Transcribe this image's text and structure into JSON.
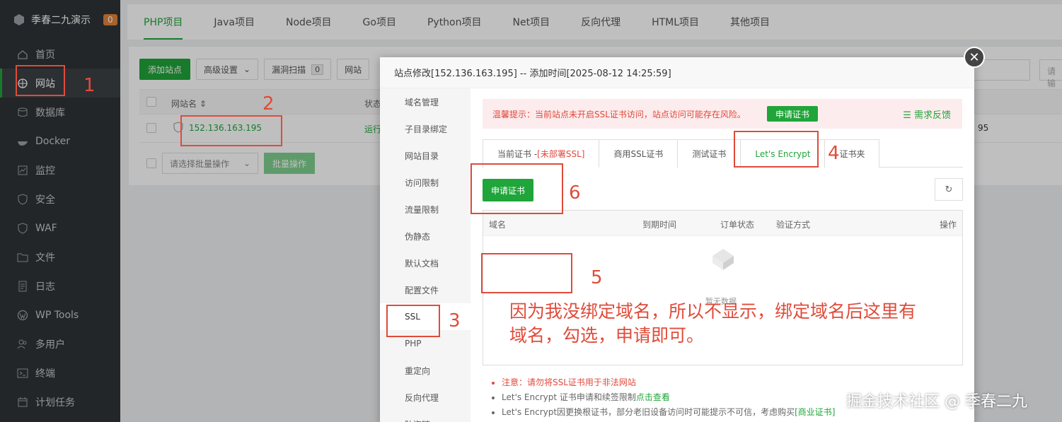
{
  "sidebar": {
    "brand": "季春二九演示",
    "badge": "0",
    "items": [
      {
        "label": "首页",
        "icon": "home-icon"
      },
      {
        "label": "网站",
        "icon": "globe-icon"
      },
      {
        "label": "数据库",
        "icon": "database-icon"
      },
      {
        "label": "Docker",
        "icon": "docker-icon"
      },
      {
        "label": "监控",
        "icon": "monitor-icon"
      },
      {
        "label": "安全",
        "icon": "shield-icon"
      },
      {
        "label": "WAF",
        "icon": "waf-icon"
      },
      {
        "label": "文件",
        "icon": "folder-icon"
      },
      {
        "label": "日志",
        "icon": "log-icon"
      },
      {
        "label": "WP Tools",
        "icon": "wordpress-icon"
      },
      {
        "label": "多用户",
        "icon": "users-icon"
      },
      {
        "label": "终端",
        "icon": "terminal-icon"
      },
      {
        "label": "计划任务",
        "icon": "calendar-icon"
      }
    ]
  },
  "top_tabs": [
    "PHP项目",
    "Java项目",
    "Node项目",
    "Go项目",
    "Python项目",
    "Net项目",
    "反向代理",
    "HTML项目",
    "其他项目"
  ],
  "toolbar": {
    "add_site": "添加站点",
    "advanced": "高级设置",
    "vuln_scan": "漏洞扫描",
    "vuln_count": "0",
    "more": "网站"
  },
  "table": {
    "col_name": "网站名 ⇕",
    "col_status": "状态",
    "row_domain": "152.136.163.195",
    "row_status": "运行",
    "row_right": "95",
    "batch_placeholder": "请选择批量操作",
    "batch_button": "批量操作",
    "search_placeholder": "请输"
  },
  "modal": {
    "title": "站点修改[152.136.163.195] -- 添加时间[2025-08-12 14:25:59]",
    "side_items": [
      "域名管理",
      "子目录绑定",
      "网站目录",
      "访问限制",
      "流量限制",
      "伪静态",
      "默认文档",
      "配置文件",
      "SSL",
      "PHP",
      "重定向",
      "反向代理",
      "防盗链"
    ],
    "alert_text": "温馨提示：当前站点未开启SSL证书访问，站点访问可能存在风险。",
    "alert_button": "申请证书",
    "feedback": "需求反馈",
    "ssl_tabs": {
      "current_prefix": "当前证书 - ",
      "current_status": "[未部署SSL]",
      "commercial": "商用SSL证书",
      "test": "测试证书",
      "letsencrypt": "Let's Encrypt",
      "folder": "证书夹"
    },
    "apply_button": "申请证书",
    "table_headers": {
      "domain": "域名",
      "expire": "到期时间",
      "order_status": "订单状态",
      "verify": "验证方式",
      "action": "操作"
    },
    "empty_text": "暂无数据",
    "notes": {
      "n1_label": "注意：请勿将SSL证书用于非法网站",
      "n2_text": "Let's Encrypt 证书申请和续签限制",
      "n2_link": "点击查看",
      "n3_text": "Let's Encrypt因更换根证书，部分老旧设备访问时可能提示不可信，考虑购买",
      "n3_link": "[商业证书]"
    }
  },
  "annotations": {
    "n1": "1",
    "n2": "2",
    "n3": "3",
    "n4": "4",
    "n5": "5",
    "n6": "6",
    "text_line1": "因为我没绑定域名，所以不显示，绑定域名后这里有",
    "text_line2": "域名，勾选，申请即可。"
  },
  "watermark": "掘金技术社区 @ 季春二九",
  "colors": {
    "accent": "#20a53a",
    "annotation": "#e04b3a",
    "sidebar": "#2f3336"
  }
}
